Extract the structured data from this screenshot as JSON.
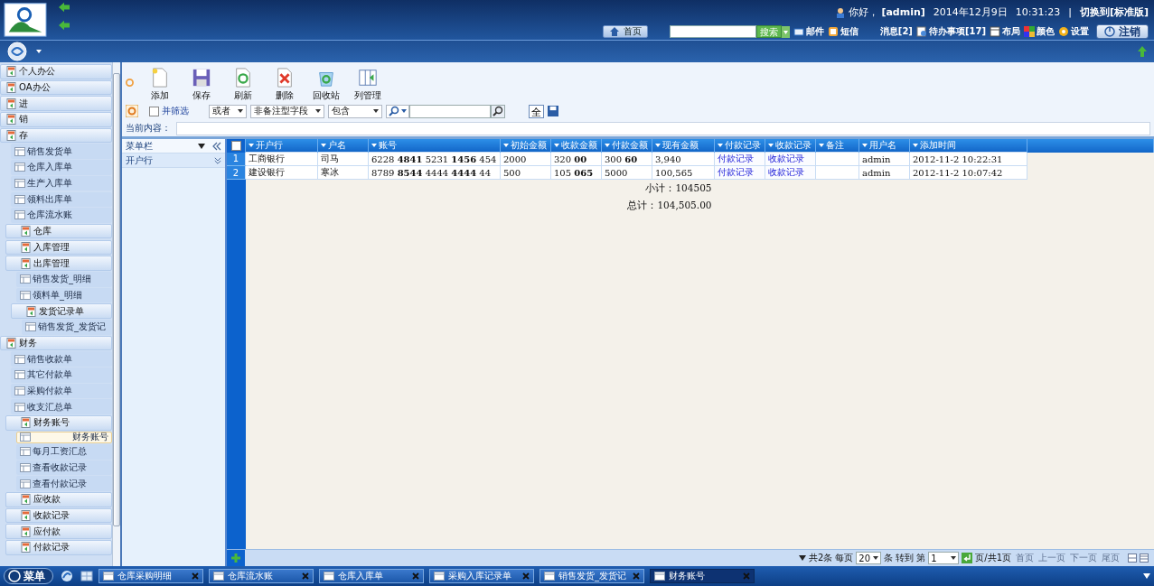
{
  "header": {
    "greeting": "你好，",
    "user": "[admin]",
    "date": "2014年12月9日",
    "time": "10:31:23",
    "separator": "|",
    "switch_link": "切换到[标准版]"
  },
  "nav": {
    "home": "首页",
    "search_button": "搜索",
    "mail": "邮件",
    "sms": "短信",
    "messages": "消息[2]",
    "todo": "待办事项[17]",
    "layout": "布局",
    "theme": "颜色",
    "settings": "设置",
    "logout": "注销"
  },
  "toolbar": {
    "buttons": [
      {
        "label": "添加",
        "kind": "add"
      },
      {
        "label": "保存",
        "kind": "save"
      },
      {
        "label": "刷新",
        "kind": "refresh"
      },
      {
        "label": "删除",
        "kind": "delete"
      },
      {
        "label": "回收站",
        "kind": "recycle"
      },
      {
        "label": "列管理",
        "kind": "columns"
      }
    ]
  },
  "filter": {
    "and_filter": {
      "label": "并筛选",
      "checked": false
    },
    "selects": [
      "或者",
      "非备注型字段",
      "包含"
    ],
    "all_button": "全"
  },
  "current": {
    "label": "当前内容："
  },
  "sidebar": {
    "items": [
      {
        "label": "个人办公",
        "kind": "module",
        "selected": false
      },
      {
        "label": "OA办公",
        "kind": "module",
        "selected": false
      },
      {
        "label": "进",
        "kind": "module",
        "selected": false
      },
      {
        "label": "销",
        "kind": "module",
        "selected": false
      },
      {
        "label": "存",
        "kind": "module",
        "selected": false,
        "children": [
          {
            "label": "销售发货单",
            "kind": "form",
            "selected": false
          },
          {
            "label": "仓库入库单",
            "kind": "form",
            "selected": false
          },
          {
            "label": "生产入库单",
            "kind": "form",
            "selected": false
          },
          {
            "label": "领料出库单",
            "kind": "form",
            "selected": false
          },
          {
            "label": "仓库流水账",
            "kind": "form",
            "selected": false
          },
          {
            "label": "仓库",
            "kind": "folder",
            "selected": false
          },
          {
            "label": "入库管理",
            "kind": "folder",
            "selected": false
          },
          {
            "label": "出库管理",
            "kind": "folder",
            "selected": false,
            "children": [
              {
                "label": "销售发货_明细",
                "kind": "form",
                "selected": false
              },
              {
                "label": "领料单_明细",
                "kind": "form",
                "selected": false
              },
              {
                "label": "发货记录单",
                "kind": "folder",
                "selected": false,
                "children": [
                  {
                    "label": "销售发货_发货记",
                    "kind": "form",
                    "selected": false
                  }
                ]
              }
            ]
          }
        ]
      },
      {
        "label": "财务",
        "kind": "module",
        "selected": false,
        "children": [
          {
            "label": "销售收款单",
            "kind": "form",
            "selected": false
          },
          {
            "label": "其它付款单",
            "kind": "form",
            "selected": false
          },
          {
            "label": "采购付款单",
            "kind": "form",
            "selected": false
          },
          {
            "label": "收支汇总单",
            "kind": "form",
            "selected": false
          },
          {
            "label": "财务账号",
            "kind": "folder",
            "selected": false,
            "children": [
              {
                "label": "财务账号",
                "kind": "form",
                "selected": true
              },
              {
                "label": "每月工资汇总",
                "kind": "form",
                "selected": false
              },
              {
                "label": "查看收款记录",
                "kind": "form",
                "selected": false
              },
              {
                "label": "查看付款记录",
                "kind": "form",
                "selected": false
              }
            ]
          },
          {
            "label": "应收款",
            "kind": "folder",
            "selected": false
          },
          {
            "label": "收款记录",
            "kind": "folder",
            "selected": false
          },
          {
            "label": "应付款",
            "kind": "folder",
            "selected": false
          },
          {
            "label": "付款记录",
            "kind": "folder",
            "selected": false
          }
        ]
      }
    ]
  },
  "side_panel": {
    "title": "菜单栏",
    "field": "开户行"
  },
  "table": {
    "select_all_checked": false,
    "columns": [
      {
        "label": "开户行",
        "kind": "text"
      },
      {
        "label": "户名",
        "kind": "text"
      },
      {
        "label": "账号",
        "kind": "text"
      },
      {
        "label": "初始金额",
        "kind": "text"
      },
      {
        "label": "收款金额",
        "kind": "text"
      },
      {
        "label": "付款金额",
        "kind": "text"
      },
      {
        "label": "现有金额",
        "kind": "text"
      },
      {
        "label": "付款记录",
        "kind": "link"
      },
      {
        "label": "收款记录",
        "kind": "link"
      },
      {
        "label": "备注",
        "kind": "text"
      },
      {
        "label": "用户名",
        "kind": "text"
      },
      {
        "label": "添加时间",
        "kind": "text"
      }
    ],
    "rows": [
      {
        "number": "1",
        "cells": [
          "工商银行",
          "司马",
          "6228 **4841** 5231 **1456** 454",
          "2000",
          "320 **00**",
          "300 **60**",
          "3,940",
          "付款记录",
          "收款记录",
          null,
          "admin",
          "2012-11-2 10:22:31"
        ]
      },
      {
        "number": "2",
        "cells": [
          "建设银行",
          "寒冰",
          "8789 **8544** 4444 **4444** 44",
          "500",
          "105 **065**",
          "5000",
          "100,565",
          "付款记录",
          "收款记录",
          null,
          "admin",
          "2012-11-2 10:07:42"
        ]
      }
    ]
  },
  "summary": {
    "subtotal": "小计：104505",
    "total": "总计：104,505.00"
  },
  "pager": {
    "total": "共2条",
    "per_page_label": "每页",
    "per_page": "20",
    "unit": "条",
    "goto": "转到 第",
    "page": "1",
    "pages": "页/共1页",
    "links": [
      {
        "label": "首页",
        "disabled": true
      },
      {
        "label": "上一页",
        "disabled": true
      },
      {
        "label": "下一页",
        "disabled": true
      },
      {
        "label": "尾页",
        "disabled": true
      }
    ]
  },
  "taskbar": {
    "menu": "菜单",
    "tabs": [
      {
        "label": "仓库采购明细",
        "selected": false
      },
      {
        "label": "仓库流水账",
        "selected": false
      },
      {
        "label": "仓库入库单",
        "selected": false
      },
      {
        "label": "采购入库记录单",
        "selected": false
      },
      {
        "label": "销售发货_发货记",
        "selected": false
      },
      {
        "label": "财务账号",
        "selected": true
      }
    ]
  }
}
